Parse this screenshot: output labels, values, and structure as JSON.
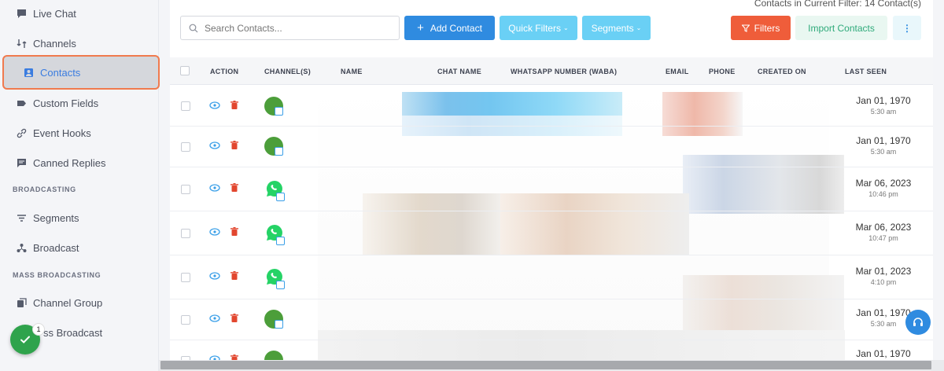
{
  "sidebar": {
    "items": [
      {
        "label": "Live Chat",
        "icon": "chat-bubble-icon"
      },
      {
        "label": "Channels",
        "icon": "channels-icon"
      },
      {
        "label": "Contacts",
        "icon": "contact-card-icon",
        "active": true
      },
      {
        "label": "Custom Fields",
        "icon": "tag-icon"
      },
      {
        "label": "Event Hooks",
        "icon": "link-icon"
      },
      {
        "label": "Canned Replies",
        "icon": "message-square-icon"
      }
    ],
    "section_broadcasting": "BROADCASTING",
    "broadcasting_items": [
      {
        "label": "Segments",
        "icon": "filter-lines-icon"
      },
      {
        "label": "Broadcast",
        "icon": "broadcast-icon"
      }
    ],
    "section_mass": "MASS BROADCASTING",
    "mass_items": [
      {
        "label": "Channel Group",
        "icon": "stack-icon"
      },
      {
        "label": "ss Broadcast",
        "icon": "broadcast-icon"
      }
    ],
    "fab_badge": "1"
  },
  "toolbar": {
    "filter_count": "Contacts in Current Filter: 14 Contact(s)",
    "search_placeholder": "Search Contacts...",
    "add_contact": "Add Contact",
    "quick_filters": "Quick Filters",
    "segments": "Segments",
    "filters": "Filters",
    "import_contacts": "Import Contacts",
    "more": "⋮"
  },
  "table": {
    "headers": [
      "ACTION",
      "CHANNEL(S)",
      "NAME",
      "CHAT NAME",
      "WHATSAPP NUMBER (WABA)",
      "EMAIL",
      "PHONE",
      "CREATED ON",
      "LAST SEEN"
    ],
    "rows": [
      {
        "channel": "green-generic",
        "seen_date": "Jan 01, 1970",
        "seen_time": "5:30 am"
      },
      {
        "channel": "green-generic",
        "seen_date": "Jan 01, 1970",
        "seen_time": "5:30 am"
      },
      {
        "channel": "whatsapp",
        "seen_date": "Mar 06, 2023",
        "seen_time": "10:46 pm"
      },
      {
        "channel": "whatsapp",
        "seen_date": "Mar 06, 2023",
        "seen_time": "10:47 pm"
      },
      {
        "channel": "whatsapp",
        "seen_date": "Mar 01, 2023",
        "seen_time": "4:10 pm"
      },
      {
        "channel": "green-generic",
        "seen_date": "Jan 01, 1970",
        "seen_time": "5:30 am"
      },
      {
        "channel": "green-generic",
        "seen_date": "Jan 01, 1970",
        "seen_time": ""
      }
    ]
  },
  "colors": {
    "accent_blue": "#2f8be0",
    "light_blue": "#6ad0f5",
    "danger": "#ef5d3a",
    "whatsapp_green": "#25d366",
    "channel_green": "#4c9e3a",
    "active_outline": "#f07a4e"
  }
}
